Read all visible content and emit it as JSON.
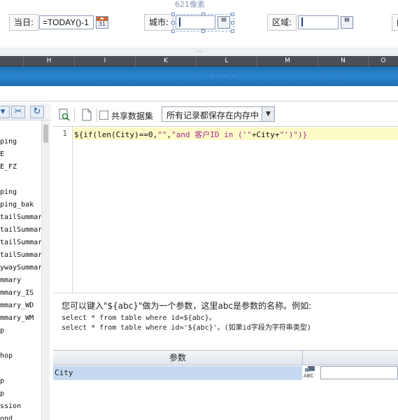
{
  "form": {
    "size_note": "621像素",
    "date_label": "当日:",
    "date_value": "=TODAY()-1",
    "date_picker_text": "31",
    "city_label": "城市:",
    "city_value": "",
    "region_label": "区域:",
    "region_value": "",
    "cut_label": "门"
  },
  "sheet": {
    "splitter_glyph": "...",
    "columns": [
      "H",
      "I",
      "K",
      "L",
      "M",
      "N",
      "O"
    ],
    "banner_text": "· ·· ·"
  },
  "datasets": [
    "ping",
    "E",
    "E_FZ",
    "",
    "ping",
    "ping_bak",
    "tailSummar:",
    "tailSummar:",
    "tailSummar:",
    "tailSummar:",
    "ywaySummar:",
    "mmary",
    "mmary_IS",
    "mmary_WD",
    "mmary_WM",
    "p",
    "",
    "hop",
    "",
    "p",
    "p",
    "ssion",
    "ond"
  ],
  "editor": {
    "share_label": "共享数据集",
    "mode_select": "所有记录都保存在内存中",
    "line_number": "1",
    "code_prefix": "${if(len(City)==0,",
    "code_empty": "\"\"",
    "code_comma": ",",
    "code_string": "\"and 客户ID in ('\"",
    "code_city": "+City+",
    "code_tail": "\"')\")}"
  },
  "hint": {
    "line1": "您可以键入\"${abc}\"做为一个参数，这里abc是参数的名称。例如:",
    "line2": "select * from table where id=${abc}。",
    "line3": "select * from table where id='${abc}'。(如果id字段为字符串类型)"
  },
  "params": {
    "header": "参数",
    "rows": [
      {
        "name": "City",
        "value": ""
      }
    ],
    "type_icon": "ABC"
  },
  "colors": {
    "banner": "#1e6fb0",
    "selection_row": "#c5daf0",
    "code_highlight": "#fdfbc8",
    "string_color": "#a62a92"
  }
}
